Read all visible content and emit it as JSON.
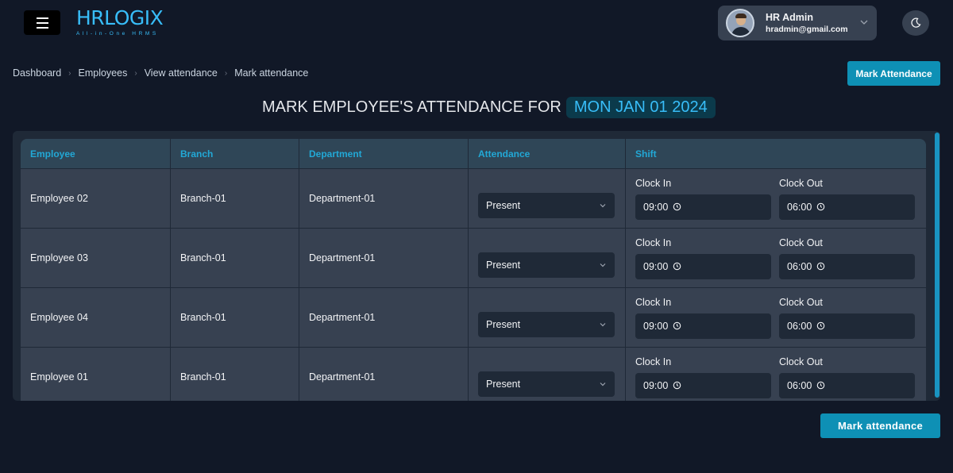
{
  "header": {
    "logo": "HRLOGIX",
    "tagline": "All-in-One HRMS",
    "user_name": "HR Admin",
    "user_email": "hradmin@gmail.com"
  },
  "breadcrumb": [
    "Dashboard",
    "Employees",
    "View attendance",
    "Mark attendance"
  ],
  "top_button_label": "Mark Attendance",
  "title": "MARK EMPLOYEE'S ATTENDANCE FOR",
  "date": "MON JAN 01 2024",
  "table": {
    "headers": [
      "Employee",
      "Branch",
      "Department",
      "Attendance",
      "Shift"
    ],
    "clock_in_label": "Clock In",
    "clock_out_label": "Clock Out",
    "rows": [
      {
        "employee": "Employee 02",
        "branch": "Branch-01",
        "department": "Department-01",
        "attendance": "Present",
        "clock_in": "09:00",
        "clock_out": "06:00"
      },
      {
        "employee": "Employee 03",
        "branch": "Branch-01",
        "department": "Department-01",
        "attendance": "Present",
        "clock_in": "09:00",
        "clock_out": "06:00"
      },
      {
        "employee": "Employee 04",
        "branch": "Branch-01",
        "department": "Department-01",
        "attendance": "Present",
        "clock_in": "09:00",
        "clock_out": "06:00"
      },
      {
        "employee": "Employee 01",
        "branch": "Branch-01",
        "department": "Department-01",
        "attendance": "Present",
        "clock_in": "09:00",
        "clock_out": "06:00"
      }
    ]
  },
  "bottom_button_label": "Mark attendance",
  "colors": {
    "accent": "#0e90b5",
    "background": "#111827",
    "panel": "#1f2937",
    "row": "#374151",
    "header_text": "#22a8d6"
  },
  "icons": {
    "menu": "hamburger-icon",
    "theme": "moon-icon",
    "dropdown": "chevron-down-icon",
    "time": "clock-icon"
  }
}
